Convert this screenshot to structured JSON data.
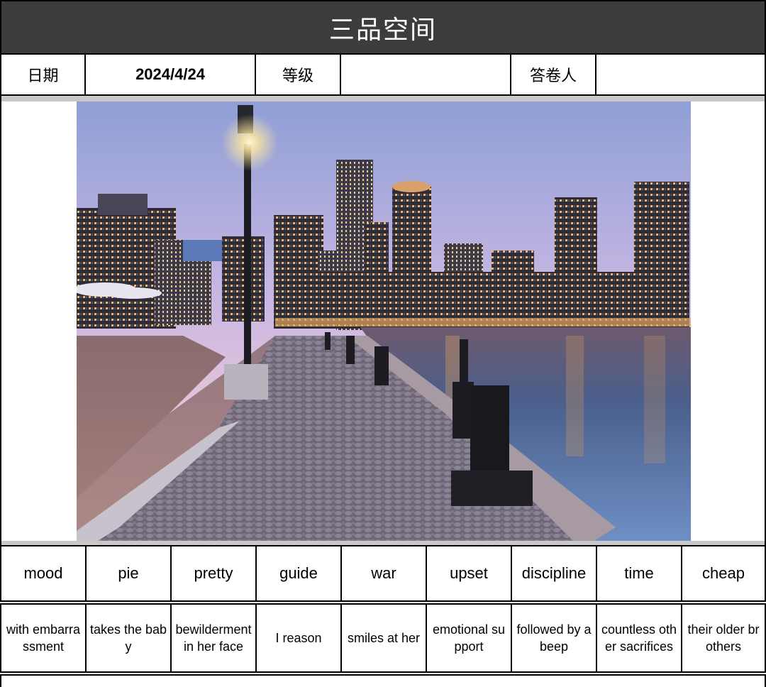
{
  "header": {
    "title": "三品空间"
  },
  "info": {
    "date_label": "日期",
    "date_value": "2024/4/24",
    "grade_label": "等级",
    "grade_value": "",
    "respondent_label": "答卷人",
    "respondent_value": ""
  },
  "words": [
    "mood",
    "pie",
    "pretty",
    "guide",
    "war",
    "upset",
    "discipline",
    "time",
    "cheap"
  ],
  "phrases": [
    "with embarrassment",
    "takes the baby",
    "bewilderment in her face",
    "I reason",
    "smiles at her",
    "emotional support",
    "followed by a beep",
    "countless other sacrifices",
    "their older brothers"
  ],
  "colors": {
    "title_bg": "#3c3c3c",
    "separator": "#c8c8c8"
  }
}
